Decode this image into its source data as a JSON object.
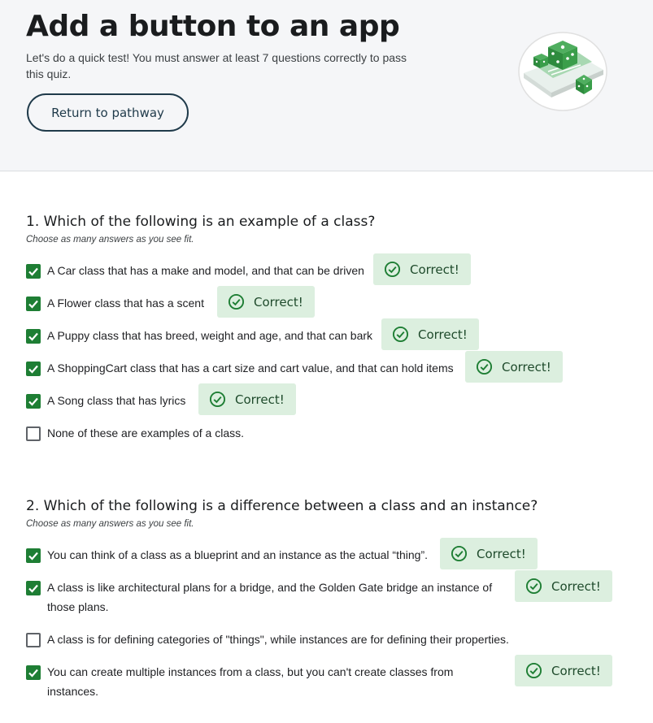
{
  "header": {
    "title": "Add a button to an app",
    "subtitle": "Let's do a quick test! You must answer at least 7 questions correctly to pass this quiz.",
    "return_label": "Return to pathway"
  },
  "questions": [
    {
      "title": "1. Which of the following is an example of a class?",
      "hint": "Choose as many answers as you see fit.",
      "options": [
        {
          "label": "A Car class that has a make and model, and that can be driven",
          "checked": true,
          "feedback": "Correct!"
        },
        {
          "label": "A Flower class that has a scent",
          "checked": true,
          "feedback": "Correct!"
        },
        {
          "label": "A Puppy class that has breed, weight and age, and that can bark",
          "checked": true,
          "feedback": "Correct!"
        },
        {
          "label": "A ShoppingCart class that has a cart size and cart value, and that can hold items",
          "checked": true,
          "feedback": "Correct!"
        },
        {
          "label": "A Song class that has lyrics",
          "checked": true,
          "feedback": "Correct!"
        },
        {
          "label": "None of these are examples of a class.",
          "checked": false,
          "feedback": ""
        }
      ]
    },
    {
      "title": "2. Which of the following is a difference between a class and an instance?",
      "hint": "Choose as many answers as you see fit.",
      "options": [
        {
          "label": "You can think of a class as a blueprint and an instance as the actual “thing”.",
          "checked": true,
          "feedback": "Correct!"
        },
        {
          "label": "A class is like architectural plans for a bridge, and the Golden Gate bridge an instance of those plans.",
          "checked": true,
          "feedback": "Correct!"
        },
        {
          "label": "A class is for defining categories of \"things\", while instances are for defining their properties.",
          "checked": false,
          "feedback": ""
        },
        {
          "label": "You can create multiple instances from a class, but you can't create classes from instances.",
          "checked": true,
          "feedback": "Correct!"
        }
      ]
    }
  ],
  "colors": {
    "accent": "#1e7e34",
    "badge_bg": "#dcefdf",
    "header_bg": "#f5f6f8"
  }
}
